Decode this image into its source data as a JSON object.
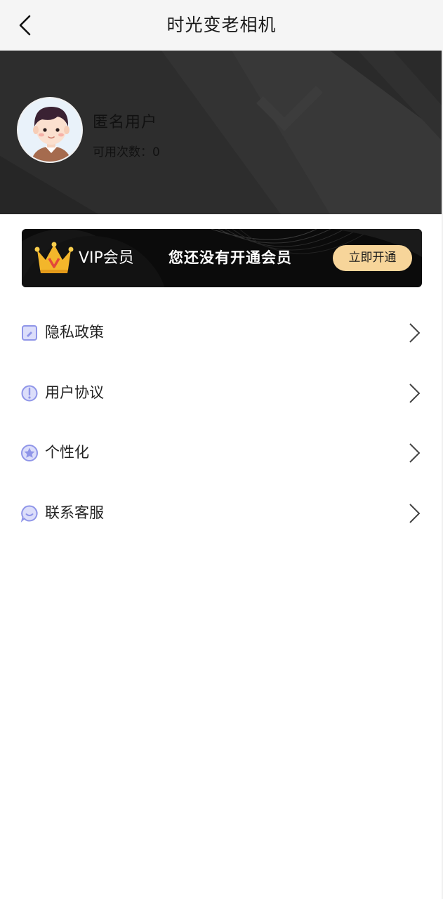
{
  "navbar": {
    "back_icon": "chevron-left-icon",
    "title": "时光变老相机"
  },
  "profile": {
    "avatar_icon": "cartoon-boy-avatar",
    "username": "匿名用户",
    "usage_count": "可用次数：0"
  },
  "vip_banner": {
    "crown_icon": "crown-icon",
    "label": "VIP会员",
    "message": "您还没有开通会员",
    "button": "立即开通",
    "button_color": "#f7d59a"
  },
  "menu": {
    "items": [
      {
        "label": "隐私政策",
        "icon": "privacy-icon"
      },
      {
        "label": "用户协议",
        "icon": "agreement-icon"
      },
      {
        "label": "个性化",
        "icon": "personalize-icon"
      },
      {
        "label": "联系客服",
        "icon": "customer-service-icon"
      }
    ],
    "accent_color": "#8f95e8"
  }
}
